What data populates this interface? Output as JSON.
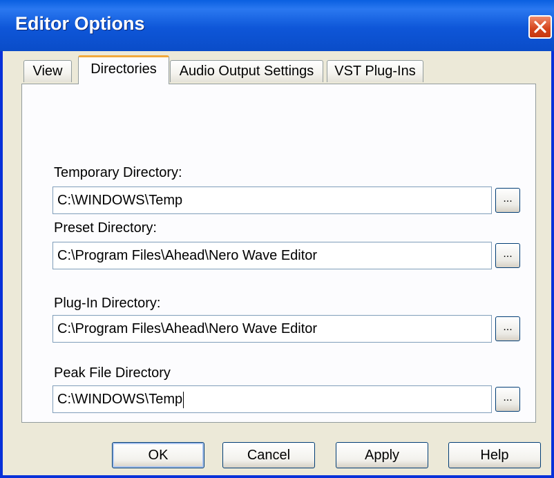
{
  "window": {
    "title": "Editor Options",
    "close_icon": "close-icon"
  },
  "tabs": [
    {
      "label": "View",
      "active": false
    },
    {
      "label": "Directories",
      "active": true
    },
    {
      "label": "Audio Output Settings",
      "active": false
    },
    {
      "label": "VST Plug-Ins",
      "active": false
    }
  ],
  "fields": [
    {
      "label": "Temporary Directory:",
      "value": "C:\\WINDOWS\\Temp",
      "browse_label": "..."
    },
    {
      "label": "Preset Directory:",
      "value": "C:\\Program Files\\Ahead\\Nero Wave Editor",
      "browse_label": "..."
    },
    {
      "label": "Plug-In Directory:",
      "value": "C:\\Program Files\\Ahead\\Nero Wave Editor",
      "browse_label": "..."
    },
    {
      "label": "Peak File Directory",
      "value": "C:\\WINDOWS\\Temp",
      "browse_label": "..."
    }
  ],
  "buttons": {
    "ok": "OK",
    "cancel": "Cancel",
    "apply": "Apply",
    "help": "Help"
  },
  "colors": {
    "title_bar": "#0a4cc8",
    "close_button": "#d4431c",
    "dialog_face": "#ece9d8",
    "active_tab_accent": "#f2a93b"
  }
}
